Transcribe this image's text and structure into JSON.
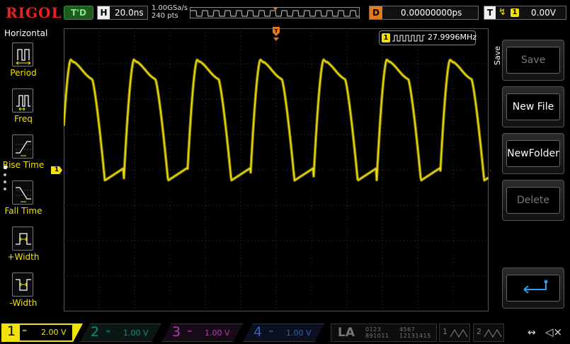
{
  "top": {
    "logo": "RIGOL",
    "trigger_status": "T'D",
    "horizontal_label": "H",
    "timebase": "20.0ns",
    "sample_rate": "1.00GSa/s",
    "mem_depth": "240  pts",
    "delay_label": "D",
    "delay_value": "0.00000000ps",
    "trigger_label": "T",
    "trigger_edge": "↯",
    "trigger_source": "1",
    "trigger_level": "0.00V"
  },
  "left_menu": {
    "title": "Horizontal",
    "items": [
      {
        "label": "Period",
        "icon": "period-icon"
      },
      {
        "label": "Freq",
        "icon": "frequency-icon"
      },
      {
        "label": "Rise Time",
        "icon": "rise-time-icon"
      },
      {
        "label": "Fall Time",
        "icon": "fall-time-icon"
      },
      {
        "label": "+Width",
        "icon": "positive-width-icon"
      },
      {
        "label": "-Width",
        "icon": "negative-width-icon"
      }
    ]
  },
  "screen": {
    "ch1_marker": "1",
    "trigger_marker": "T",
    "measurement": {
      "channel": "1",
      "value": "27.9996MHz"
    }
  },
  "right_menu": {
    "tab": "Save",
    "buttons": [
      {
        "label": "Save",
        "enabled": false
      },
      {
        "label": "New File",
        "enabled": true
      },
      {
        "label": "NewFolder",
        "enabled": true
      },
      {
        "label": "Delete",
        "enabled": false
      },
      {
        "label": "",
        "icon": "return-icon",
        "enabled": true
      }
    ]
  },
  "bottom": {
    "channels": [
      {
        "num": "1",
        "coupling": "═",
        "scale": "2.00 V",
        "active": true,
        "color": "#f2e20a"
      },
      {
        "num": "2",
        "coupling": "═",
        "scale": "1.00 V",
        "active": false,
        "color": "#1a8a80"
      },
      {
        "num": "3",
        "coupling": "═",
        "scale": "1.00 V",
        "active": false,
        "color": "#b13fb1"
      },
      {
        "num": "4",
        "coupling": "═",
        "scale": "1.00 V",
        "active": false,
        "color": "#3a5fb0"
      }
    ],
    "la": {
      "label": "LA",
      "group1_top": "0123",
      "group1_bottom": "891011",
      "group2_top": "4567",
      "group2_bottom": "12131415"
    },
    "decoders": [
      {
        "num": "1"
      },
      {
        "num": "2"
      }
    ],
    "usb_icon": "usb-icon",
    "speaker_icon": "speaker-muted-icon"
  },
  "colors": {
    "ch1": "#f2e20a",
    "trigger": "#e07a1a",
    "logo": "#e8201f",
    "grid": "#3a3a3a"
  },
  "waveform": {
    "frequency_mhz": 27.9996,
    "timebase_ns_per_div": 20,
    "high_level_divs": 3.0,
    "low_level_divs": -0.3
  }
}
